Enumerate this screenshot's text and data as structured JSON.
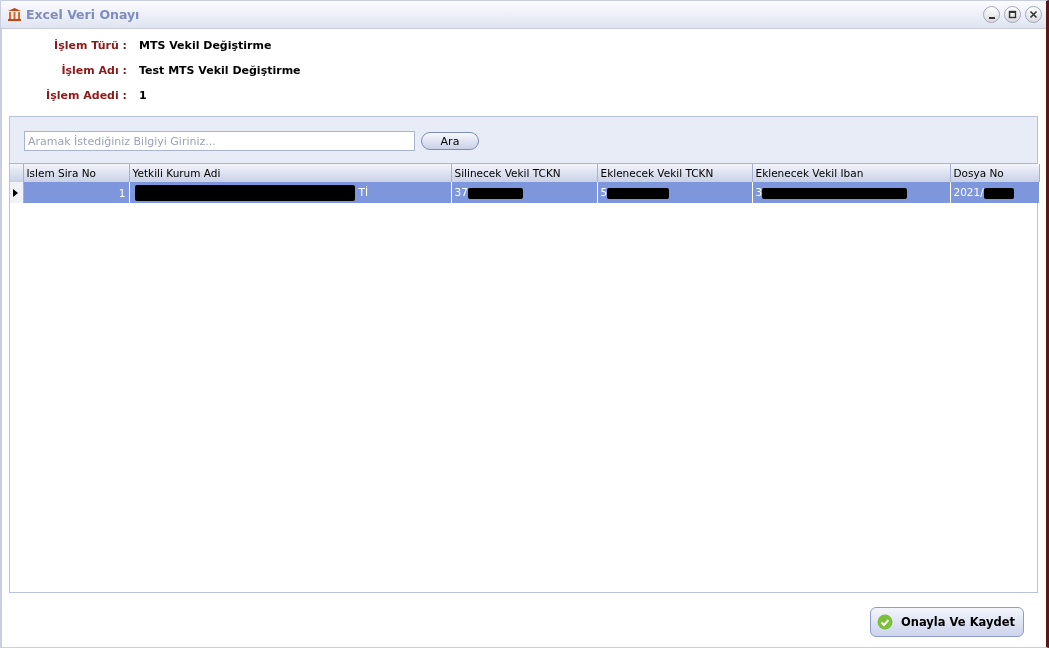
{
  "window": {
    "title": "Excel Veri Onayı"
  },
  "info": [
    {
      "label": "İşlem Türü :",
      "value": "MTS Vekil Değiştirme"
    },
    {
      "label": "İşlem Adı :",
      "value": "Test MTS Vekil Değiştirme"
    },
    {
      "label": "İşlem Adedi :",
      "value": "1"
    }
  ],
  "search": {
    "placeholder": "Aramak İstediğiniz Bilgiyi Giriniz...",
    "button": "Ara"
  },
  "table": {
    "columns": [
      "Islem Sira No",
      "Yetkili Kurum Adi",
      "Silinecek Vekil TCKN",
      "Eklenecek Vekil TCKN",
      "Eklenecek Vekil Iban",
      "Dosya No"
    ],
    "rows": [
      {
        "selected": true,
        "cells": [
          {
            "text": "1",
            "kind": "plain"
          },
          {
            "text": "Tİ",
            "kind": "masked_lead"
          },
          {
            "text": "37",
            "kind": "masked_tail"
          },
          {
            "text": "5",
            "kind": "masked_tail"
          },
          {
            "text": "3",
            "kind": "masked_tail"
          },
          {
            "text": "2021/",
            "kind": "masked_tail"
          }
        ]
      }
    ]
  },
  "footer": {
    "button": "Onayla Ve Kaydet"
  }
}
